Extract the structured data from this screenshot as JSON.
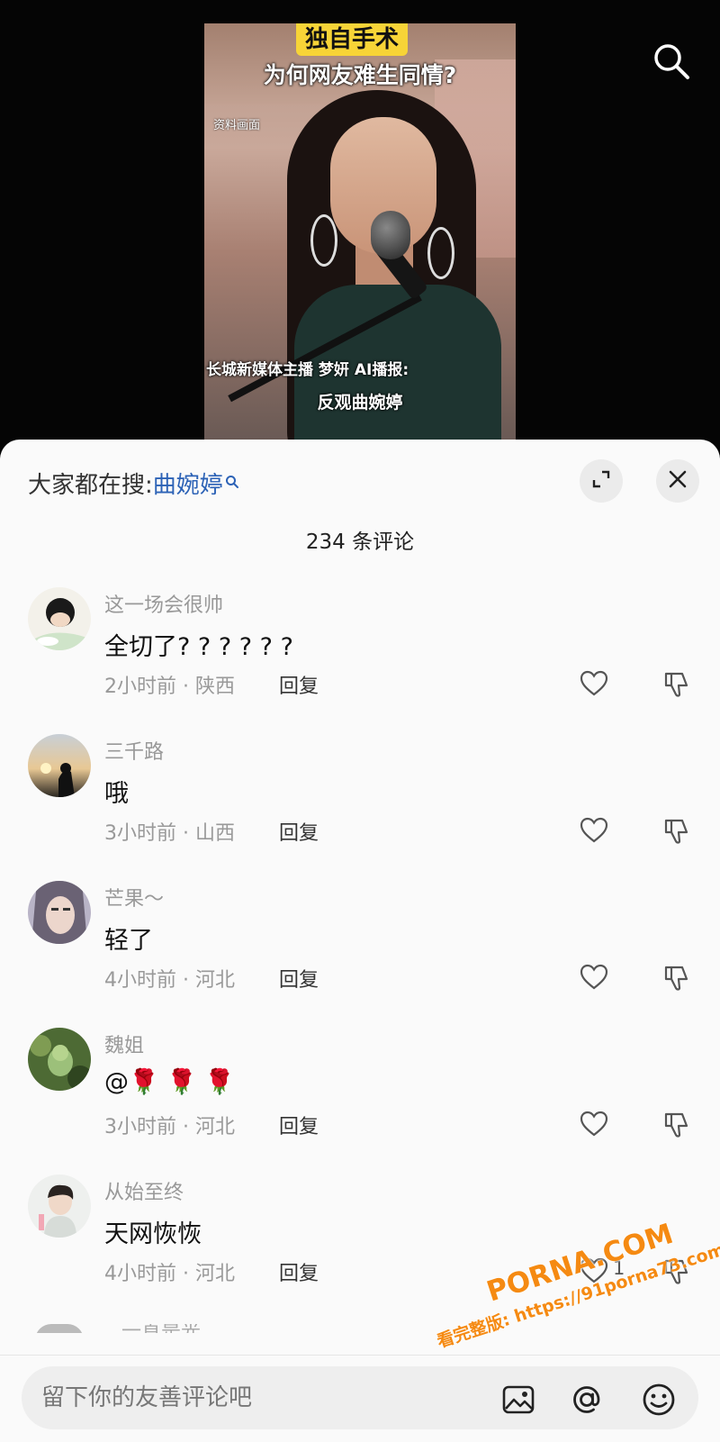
{
  "video": {
    "tag": "独自手术",
    "headline": "为何网友难生同情?",
    "note": "资料画面",
    "caption_line1": "长城新媒体主播 梦妍 AI播报:",
    "caption_line2": "反观曲婉婷"
  },
  "sheet": {
    "trending_prefix": "大家都在搜:",
    "trending_keyword": "曲婉婷",
    "comment_count": "234 条评论"
  },
  "comments": [
    {
      "user": "这一场会很帅",
      "text": "全切了? ? ? ? ? ?",
      "time_location": "2小时前 · 陕西",
      "reply": "回复",
      "likes": ""
    },
    {
      "user": "三千路",
      "text": "哦",
      "time_location": "3小时前 · 山西",
      "reply": "回复",
      "likes": ""
    },
    {
      "user": "芒果～",
      "text": "轻了",
      "time_location": "4小时前 · 河北",
      "reply": "回复",
      "likes": ""
    },
    {
      "user": "魏姐",
      "text": "@🌹 🌹 🌹",
      "time_location": "3小时前 · 河北",
      "reply": "回复",
      "likes": ""
    },
    {
      "user": "从始至终",
      "text": "天网恢恢",
      "time_location": "4小时前 · 河北",
      "reply": "回复",
      "likes": "1"
    }
  ],
  "peek_comment": {
    "user": "一直是光"
  },
  "input": {
    "placeholder": "留下你的友善评论吧"
  },
  "watermark": {
    "brand": "PORNA.COM",
    "line": "看完整版: https://91porna73.com"
  },
  "colors": {
    "keyword": "#2c62b6",
    "tag_yellow": "#f7d437",
    "watermark": "#f58a12"
  }
}
